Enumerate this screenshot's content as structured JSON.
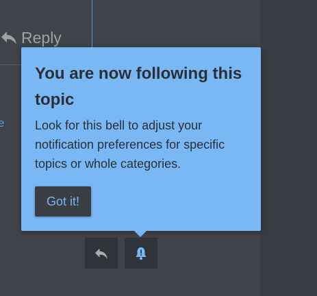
{
  "post": {
    "reply_label": "Reply",
    "reply_icon": "reply-icon",
    "edge_link_text": "e"
  },
  "tooltip": {
    "title": "You are now following this topic",
    "body": "Look for this bell to adjust your notification preferences for specific topics or whole categories.",
    "button_label": "Got it!"
  },
  "actions": {
    "reply_icon": "reply-icon",
    "bell_icon": "bell-alert-icon"
  },
  "colors": {
    "background": "#3c3f45",
    "tooltip_bg": "#7ab7f5",
    "tooltip_text": "#2b2f36",
    "button_bg": "#3a3d44",
    "accent": "#5b9ae0",
    "muted_text": "#9ea1a6"
  }
}
